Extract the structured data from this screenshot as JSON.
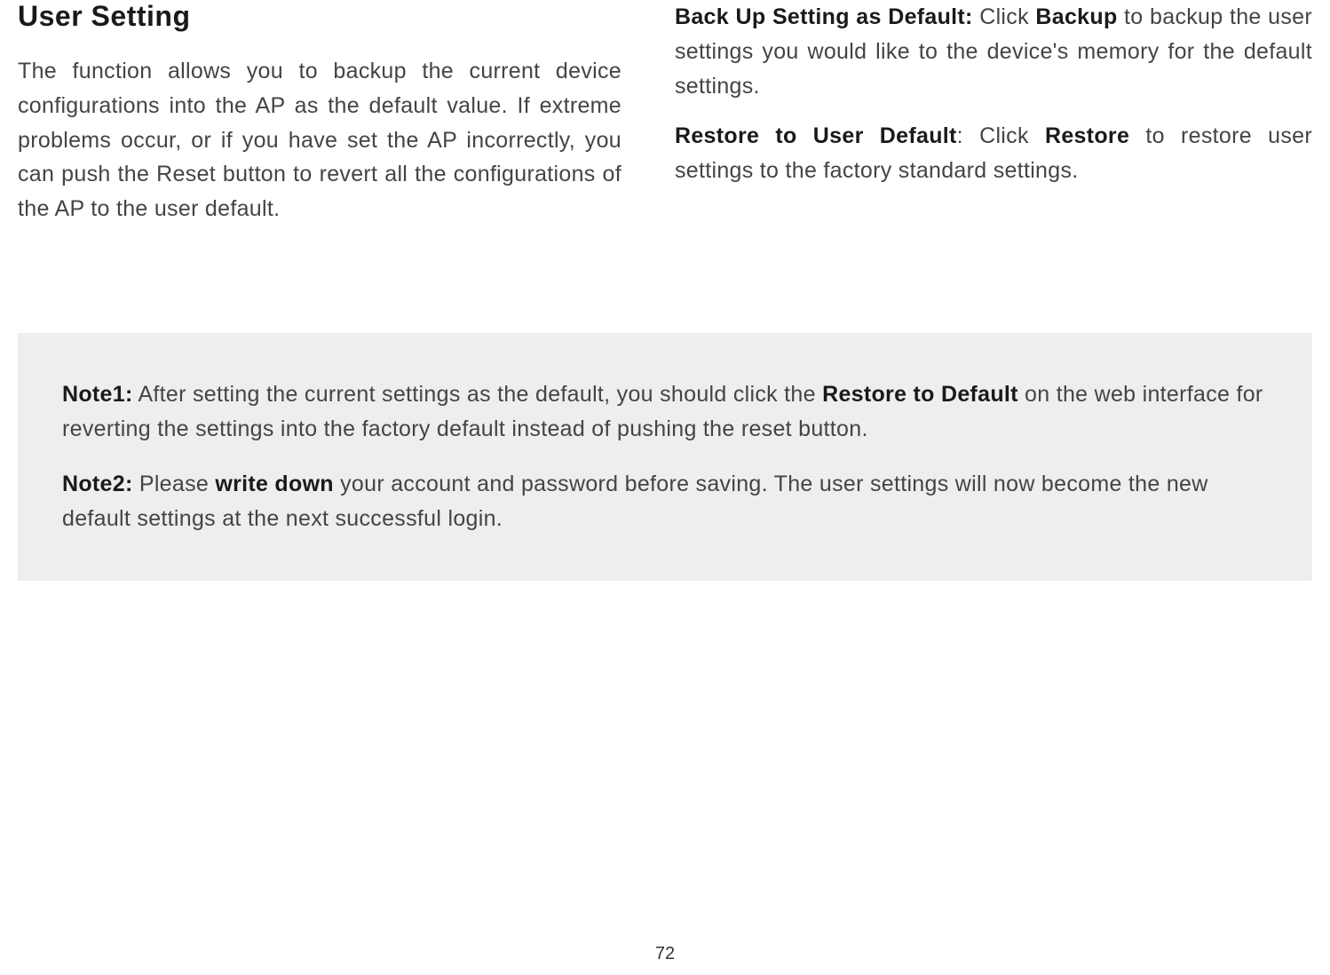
{
  "heading": "User Setting",
  "leftParagraph": "The function allows you to backup the current device configurations into the AP as the default value. If extreme problems occur, or if you have set the AP incorrectly, you can push the Reset button to revert all the configurations of the AP to the user default.",
  "rightPara1": {
    "label": "Back Up Setting as Default:",
    "prefix": "  Click ",
    "action": "Backup",
    "suffix": " to backup the user settings you would like to the device's memory for the default settings."
  },
  "rightPara2": {
    "label": "Restore to User Default",
    "prefix": ": Click ",
    "action": "Restore",
    "suffix": " to restore user settings to the factory standard settings."
  },
  "note1": {
    "label": "Note1:",
    "text1": " After setting the current settings as the default, you should click the ",
    "bold1": "Restore to Default",
    "text2": " on the web interface for reverting the settings into the factory default instead of pushing the reset button."
  },
  "note2": {
    "label": "Note2:",
    "text1": " Please ",
    "bold1": "write down",
    "text2": " your account and password before saving. The user settings will now become the new default settings at the next successful login."
  },
  "pageNumber": "72"
}
